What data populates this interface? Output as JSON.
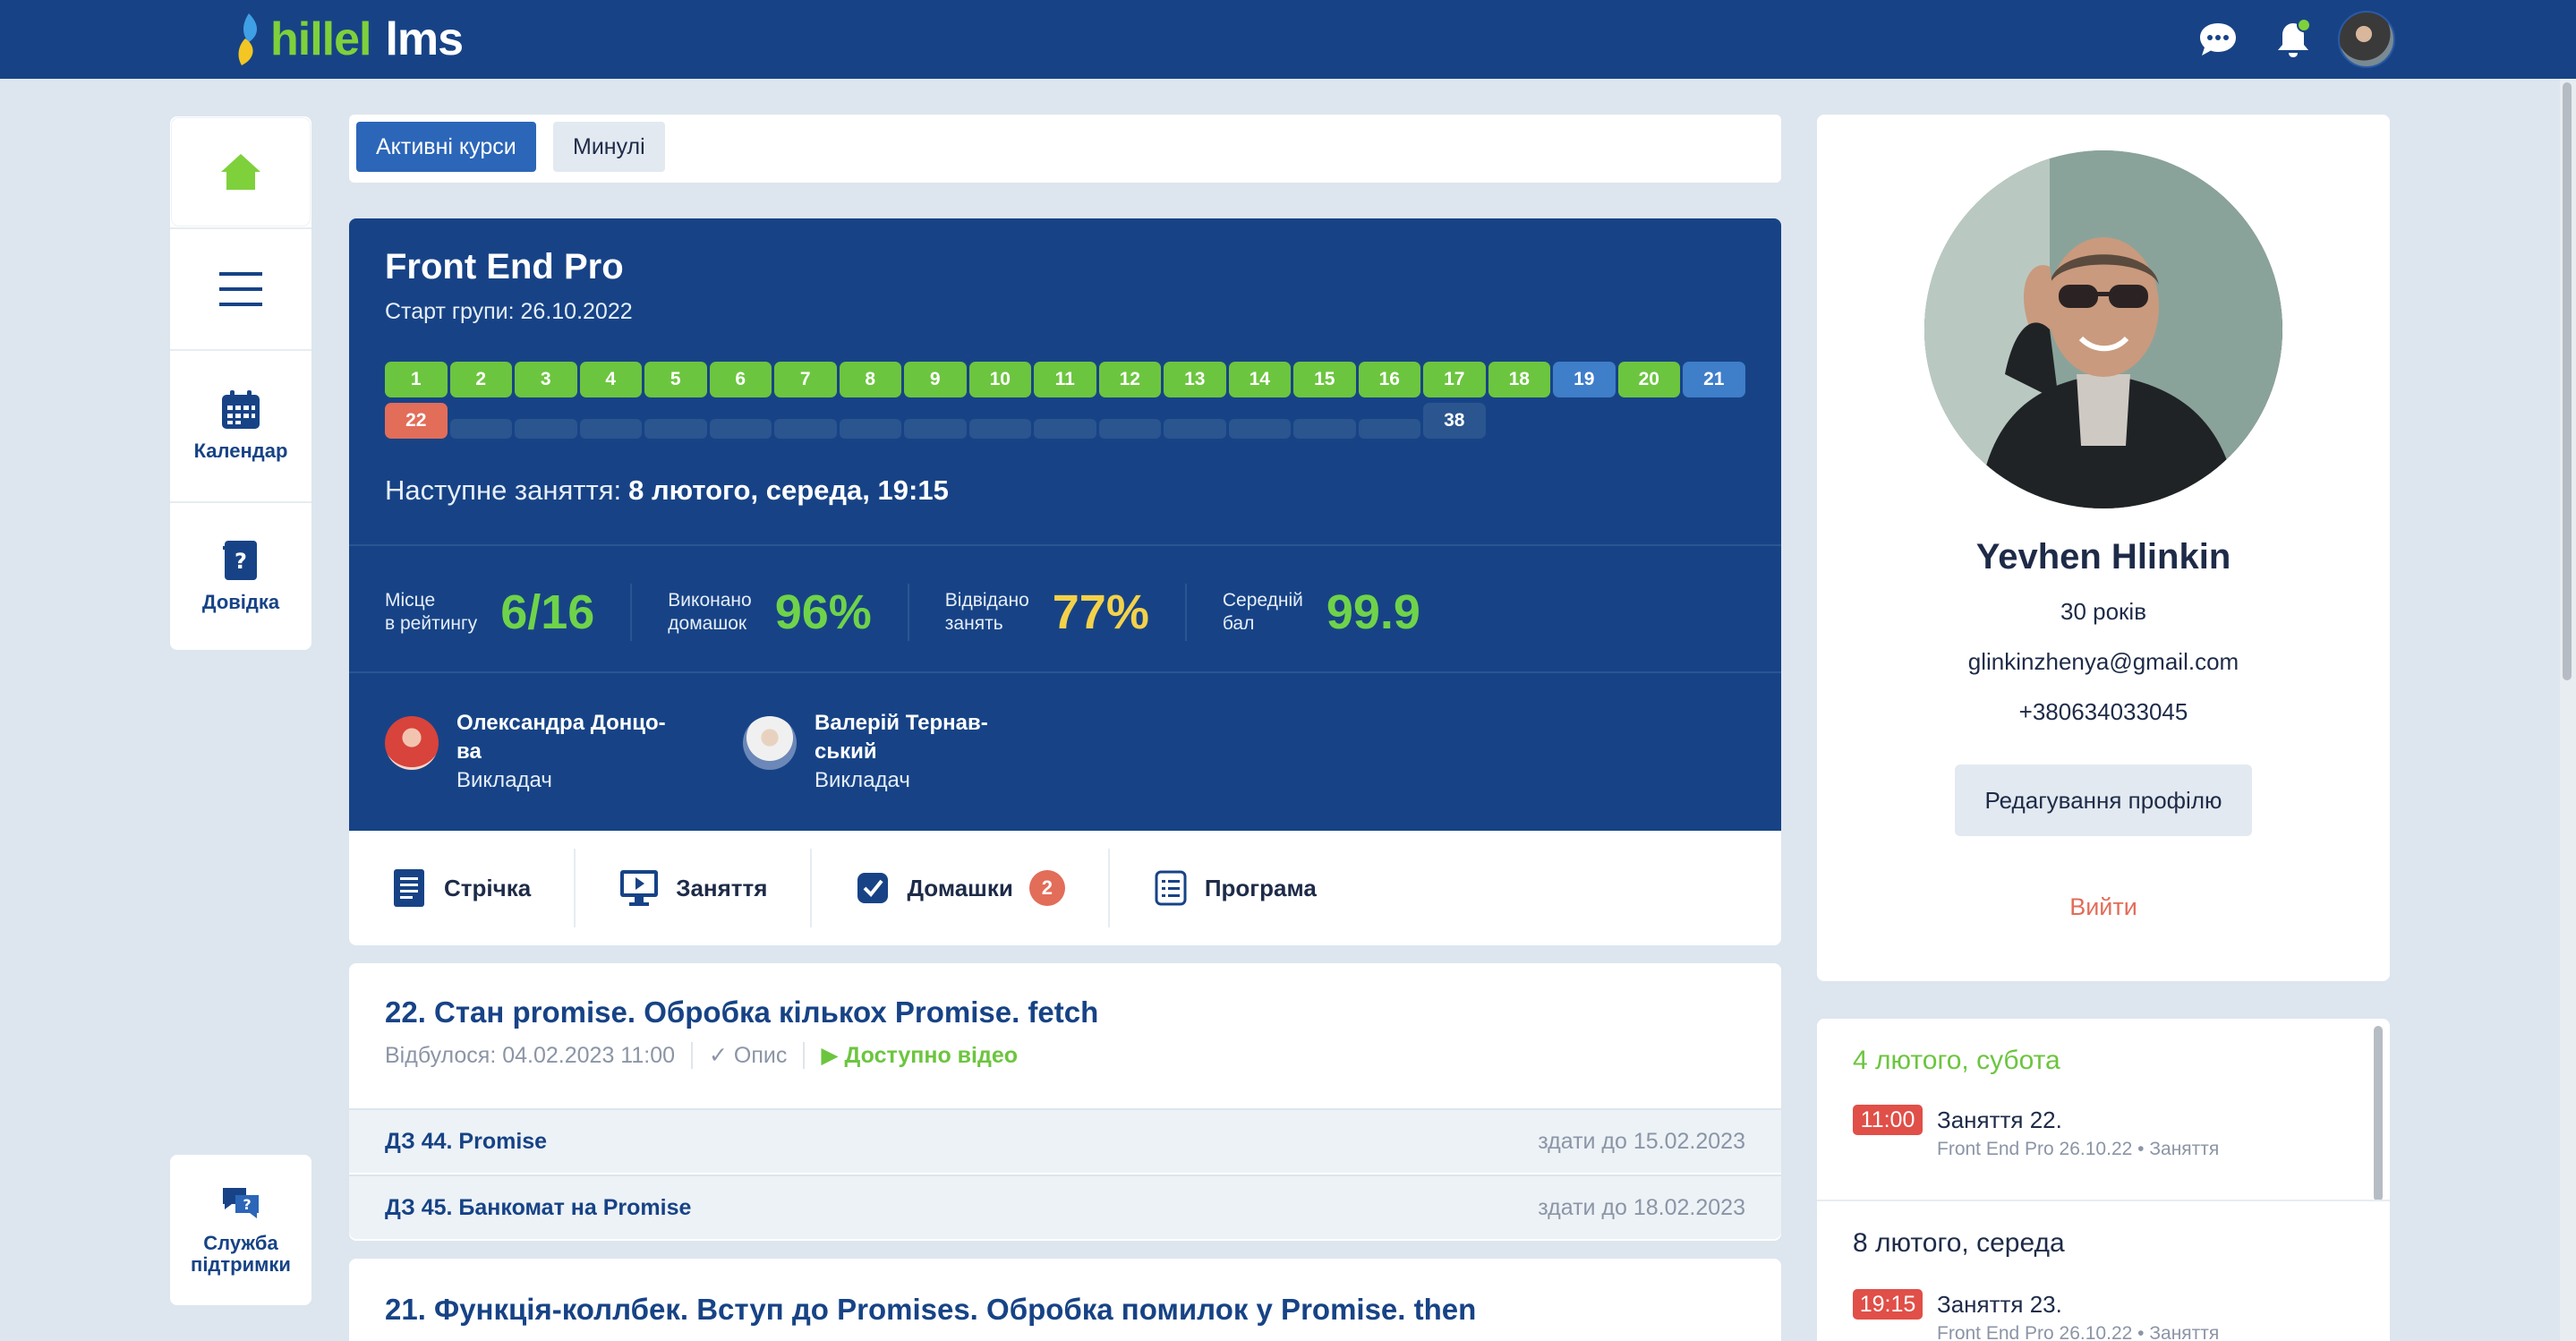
{
  "header": {
    "logo_part1": "hillel",
    "logo_part2": "lms",
    "icons": [
      "chat-icon",
      "bell-icon"
    ],
    "brand_color": "#174386",
    "accent_color": "#7ed13b"
  },
  "sidebar": {
    "items": [
      {
        "name": "home",
        "label": ""
      },
      {
        "name": "menu",
        "label": ""
      },
      {
        "name": "calendar",
        "label": "Календар"
      },
      {
        "name": "help",
        "label": "Довідка"
      }
    ],
    "support_label_1": "Служба",
    "support_label_2": "підтримки"
  },
  "tabs": {
    "active": "Активні курси",
    "past": "Минулі"
  },
  "course": {
    "title": "Front End Pro",
    "start": "Старт групи: 26.10.2022",
    "lessons_row1": [
      {
        "n": "1",
        "s": "ok"
      },
      {
        "n": "2",
        "s": "ok"
      },
      {
        "n": "3",
        "s": "ok"
      },
      {
        "n": "4",
        "s": "ok"
      },
      {
        "n": "5",
        "s": "ok"
      },
      {
        "n": "6",
        "s": "ok"
      },
      {
        "n": "7",
        "s": "ok"
      },
      {
        "n": "8",
        "s": "ok"
      },
      {
        "n": "9",
        "s": "ok"
      },
      {
        "n": "10",
        "s": "ok"
      },
      {
        "n": "11",
        "s": "ok"
      },
      {
        "n": "12",
        "s": "ok"
      },
      {
        "n": "13",
        "s": "ok"
      },
      {
        "n": "14",
        "s": "ok"
      },
      {
        "n": "15",
        "s": "ok"
      },
      {
        "n": "16",
        "s": "ok"
      },
      {
        "n": "17",
        "s": "ok"
      },
      {
        "n": "18",
        "s": "ok"
      },
      {
        "n": "19",
        "s": "blue"
      },
      {
        "n": "20",
        "s": "ok"
      },
      {
        "n": "21",
        "s": "blue"
      }
    ],
    "lessons_row2": [
      {
        "n": "22",
        "s": "red"
      },
      {
        "n": "",
        "s": "empty"
      },
      {
        "n": "",
        "s": "empty"
      },
      {
        "n": "",
        "s": "empty"
      },
      {
        "n": "",
        "s": "empty"
      },
      {
        "n": "",
        "s": "empty"
      },
      {
        "n": "",
        "s": "empty"
      },
      {
        "n": "",
        "s": "empty"
      },
      {
        "n": "",
        "s": "empty"
      },
      {
        "n": "",
        "s": "empty"
      },
      {
        "n": "",
        "s": "empty"
      },
      {
        "n": "",
        "s": "empty"
      },
      {
        "n": "",
        "s": "empty"
      },
      {
        "n": "",
        "s": "empty"
      },
      {
        "n": "",
        "s": "empty"
      },
      {
        "n": "",
        "s": "empty"
      },
      {
        "n": "38",
        "s": "num"
      }
    ],
    "next_label": "Наступне заняття:",
    "next_value": "8 лютого, середа, 19:15",
    "stats": [
      {
        "l1": "Місце",
        "l2": "в рейтингу",
        "value": "6/16",
        "color": "green"
      },
      {
        "l1": "Виконано",
        "l2": "домашок",
        "value": "96%",
        "color": "green"
      },
      {
        "l1": "Відвідано",
        "l2": "занять",
        "value": "77%",
        "color": "yellow"
      },
      {
        "l1": "Середній",
        "l2": "бал",
        "value": "99.9",
        "color": "green"
      }
    ],
    "teachers": [
      {
        "name1": "Олександра Донцо-",
        "name2": "ва",
        "role": "Викладач"
      },
      {
        "name1": "Валерій Тернав-",
        "name2": "ський",
        "role": "Викладач"
      }
    ]
  },
  "nav": {
    "feed": "Стрічка",
    "lessons": "Заняття",
    "homework": "Домашки",
    "homework_count": "2",
    "program": "Програма"
  },
  "lesson_cards": [
    {
      "title": "22. Стан promise. Обробка кількох Promise. fetch",
      "held": "Відбулося: 04.02.2023 11:00",
      "desc": "✓ Опис",
      "video": "▶ Доступно відео",
      "homeworks": [
        {
          "name": "ДЗ 44. Promise",
          "due": "здати до 15.02.2023"
        },
        {
          "name": "ДЗ 45. Банкомат на Promise",
          "due": "здати до 18.02.2023"
        }
      ]
    },
    {
      "title": "21. Функція-коллбек. Вступ до Promises. Обробка помилок у Promise. then"
    }
  ],
  "profile": {
    "name": "Yevhen Hlinkin",
    "age": "30 років",
    "email": "glinkinzhenya@gmail.com",
    "phone": "+380634033045",
    "edit": "Редагування профілю",
    "logout": "Вийти"
  },
  "schedule": [
    {
      "day": "4 лютого, субота",
      "time": "11:00",
      "title": "Заняття 22.",
      "sub": "Front End Pro 26.10.22 • Заняття",
      "day_color": "#6cc53f"
    },
    {
      "day": "8 лютого, середа",
      "time": "19:15",
      "title": "Заняття 23.",
      "sub": "Front End Pro 26.10.22 • Заняття",
      "day_color": "#1e2b48"
    }
  ]
}
